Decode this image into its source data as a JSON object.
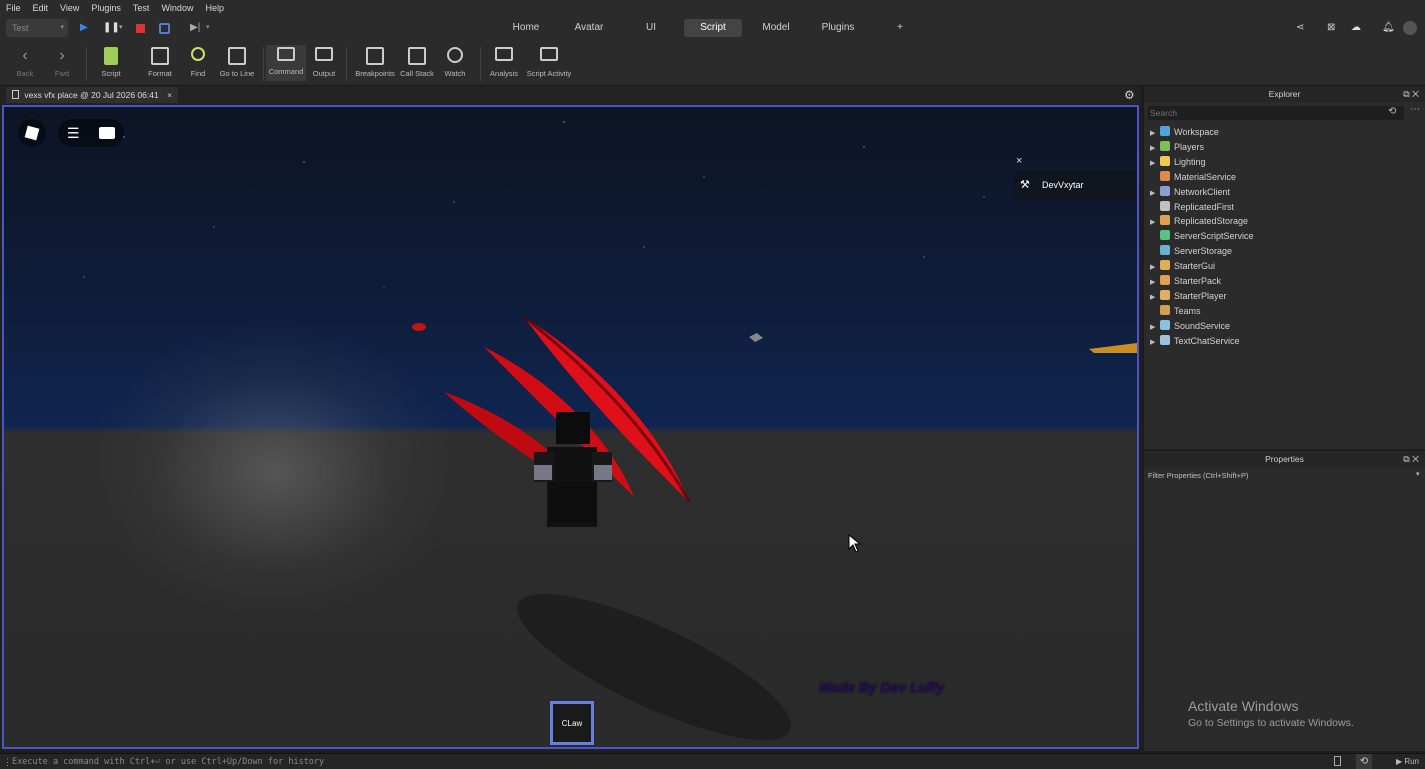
{
  "menu": [
    "File",
    "Edit",
    "View",
    "Plugins",
    "Test",
    "Window",
    "Help"
  ],
  "mode_select": "Test",
  "ribbon_tabs": [
    {
      "label": "Home",
      "active": false
    },
    {
      "label": "Avatar",
      "active": false
    },
    {
      "label": "UI",
      "active": false
    },
    {
      "label": "Script",
      "active": true
    },
    {
      "label": "Model",
      "active": false
    },
    {
      "label": "Plugins",
      "active": false
    },
    {
      "label": "+",
      "active": false
    }
  ],
  "toolbar": {
    "back": "Back",
    "fwd": "Fwd",
    "script": "Script",
    "format": "Format",
    "find": "Find",
    "goto_line": "Go to Line",
    "command": "Command",
    "output": "Output",
    "breakpoints": "Breakpoints",
    "call_stack": "Call Stack",
    "watch": "Watch",
    "analysis": "Analysis",
    "script_activity": "Script Activity"
  },
  "doc_tab": {
    "label": "vexs vfx place @ 20 Jul 2026 06:41",
    "close": "×"
  },
  "viewport": {
    "player_list": {
      "close": "×",
      "player": "DevVxytar"
    },
    "watermark": "Made By Dev Luffy",
    "hotbar_slot": "CLaw",
    "colors": {
      "claw_red": "#e0101a",
      "border": "#4a55c8",
      "watermark": "#3a1a6e"
    }
  },
  "explorer": {
    "title": "Explorer",
    "search_placeholder": "Search",
    "items": [
      {
        "label": "Workspace",
        "expandable": true,
        "icon_color": "#4fa3e0"
      },
      {
        "label": "Players",
        "expandable": true,
        "icon_color": "#7fbf5a"
      },
      {
        "label": "Lighting",
        "expandable": true,
        "icon_color": "#f2c94c"
      },
      {
        "label": "MaterialService",
        "expandable": false,
        "icon_color": "#e08a4f"
      },
      {
        "label": "NetworkClient",
        "expandable": true,
        "icon_color": "#8aa0d0"
      },
      {
        "label": "ReplicatedFirst",
        "expandable": false,
        "icon_color": "#c0c0c0"
      },
      {
        "label": "ReplicatedStorage",
        "expandable": true,
        "icon_color": "#e0a04f"
      },
      {
        "label": "ServerScriptService",
        "expandable": false,
        "icon_color": "#5ac08a"
      },
      {
        "label": "ServerStorage",
        "expandable": false,
        "icon_color": "#6ab0d0"
      },
      {
        "label": "StarterGui",
        "expandable": true,
        "icon_color": "#e0b04f"
      },
      {
        "label": "StarterPack",
        "expandable": true,
        "icon_color": "#e0a04f"
      },
      {
        "label": "StarterPlayer",
        "expandable": true,
        "icon_color": "#e0b060"
      },
      {
        "label": "Teams",
        "expandable": false,
        "icon_color": "#d0a050"
      },
      {
        "label": "SoundService",
        "expandable": true,
        "icon_color": "#8ac0e0"
      },
      {
        "label": "TextChatService",
        "expandable": true,
        "icon_color": "#a0c0e0"
      }
    ]
  },
  "properties": {
    "title": "Properties",
    "filter_placeholder": "Filter Properties (Ctrl+Shift+P)"
  },
  "activate_windows": {
    "title": "Activate Windows",
    "subtitle": "Go to Settings to activate Windows."
  },
  "command_bar": {
    "placeholder": "Execute a command with Ctrl+⏎ or use Ctrl+Up/Down for history",
    "run": "Run"
  }
}
